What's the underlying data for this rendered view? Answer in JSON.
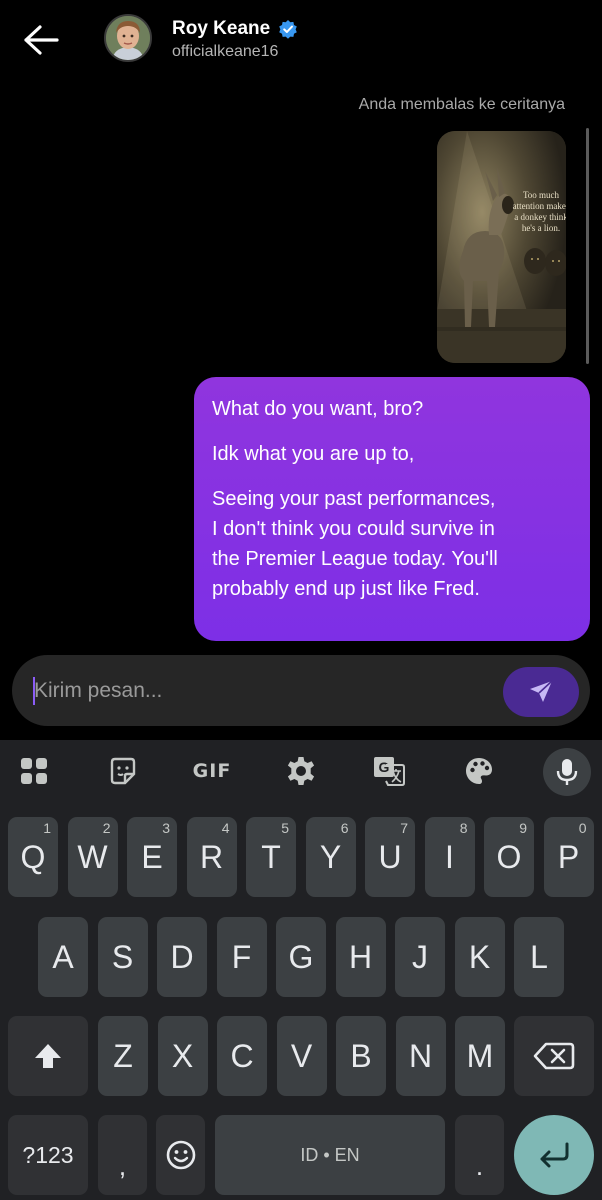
{
  "header": {
    "back_icon": "arrow-left-icon",
    "name": "Roy Keane",
    "verified_icon": "verified-badge-icon",
    "handle": "officialkeane16"
  },
  "chat": {
    "reply_note": "Anda membalas ke ceritanya",
    "story": {
      "caption_lines": [
        "Too much",
        "attention makes",
        "a donkey think",
        "he's a lion."
      ]
    },
    "message_lines": [
      "What do you want, bro?",
      "",
      "Idk what you are up to,",
      "",
      "Seeing your past performances,",
      "I don't think you could survive in",
      "the Premier League today. You'll",
      "probably end up just like Fred."
    ]
  },
  "composer": {
    "placeholder": "Kirim pesan...",
    "value": "",
    "send_icon": "send-icon"
  },
  "keyboard": {
    "toolbar": {
      "apps_icon": "apps-grid-icon",
      "sticker_icon": "sticker-icon",
      "gif_label": "GIF",
      "settings_icon": "gear-icon",
      "translate_icon": "translate-icon",
      "theme_icon": "palette-icon",
      "mic_icon": "mic-icon"
    },
    "row1": [
      {
        "ch": "Q",
        "hint": "1"
      },
      {
        "ch": "W",
        "hint": "2"
      },
      {
        "ch": "E",
        "hint": "3"
      },
      {
        "ch": "R",
        "hint": "4"
      },
      {
        "ch": "T",
        "hint": "5"
      },
      {
        "ch": "Y",
        "hint": "6"
      },
      {
        "ch": "U",
        "hint": "7"
      },
      {
        "ch": "I",
        "hint": "8"
      },
      {
        "ch": "O",
        "hint": "9"
      },
      {
        "ch": "P",
        "hint": "0"
      }
    ],
    "row2": [
      "A",
      "S",
      "D",
      "F",
      "G",
      "H",
      "J",
      "K",
      "L"
    ],
    "row3": [
      "Z",
      "X",
      "C",
      "V",
      "B",
      "N",
      "M"
    ],
    "shift_icon": "shift-icon",
    "backspace_icon": "backspace-icon",
    "symbols_label": "?123",
    "comma": ",",
    "emoji_icon": "emoji-icon",
    "space_label": "ID • EN",
    "period": ".",
    "enter_icon": "enter-icon"
  },
  "colors": {
    "bubble_gradient_top": "#9035de",
    "bubble_gradient_bottom": "#7d2fe6",
    "send_button": "#4a2a93",
    "verified": "#3897f0",
    "enter_key": "#7fb8b5",
    "keyboard_bg": "#202124",
    "key_bg": "#3c4043"
  }
}
